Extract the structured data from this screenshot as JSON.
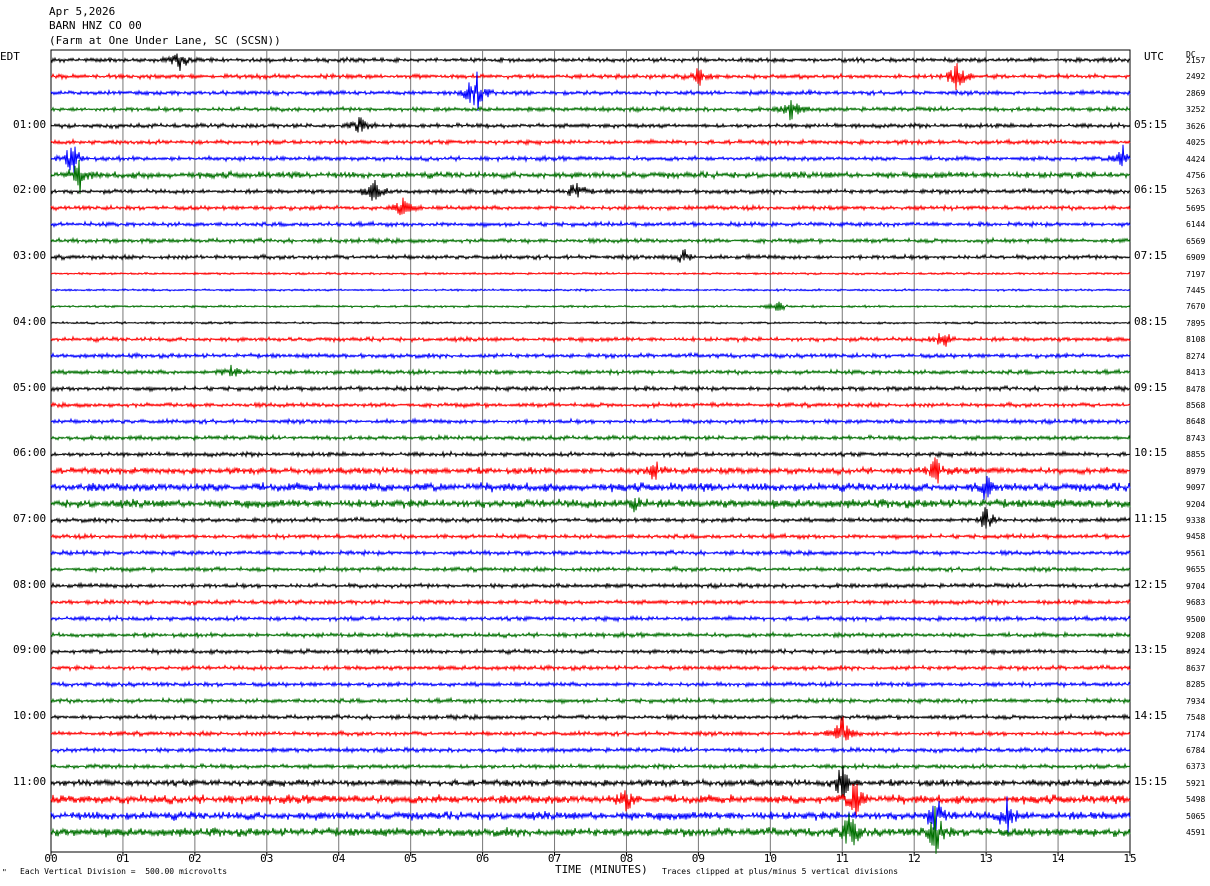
{
  "header": {
    "date": "Apr 5,2026",
    "station": "BARN HNZ CO 00",
    "location": "(Farm at One Under Lane, SC (SCSN))"
  },
  "labels": {
    "left_tz": "EDT",
    "right_tz": "UTC",
    "dc_label": "DC"
  },
  "footer": {
    "scale_note": "Each Vertical Division =  500.00 microvolts",
    "xaxis_title": "TIME (MINUTES)",
    "clip_note": "Traces clipped at plus/minus 5 vertical divisions",
    "corner_mark": "\""
  },
  "colors": {
    "cycle": [
      "#000000",
      "#ff0000",
      "#0000ff",
      "#007000"
    ]
  },
  "chart_data": {
    "type": "line",
    "title": "BARN HNZ CO 00",
    "xlabel": "TIME (MINUTES)",
    "xlim": [
      0,
      15
    ],
    "x_ticks": [
      "00",
      "01",
      "02",
      "03",
      "04",
      "05",
      "06",
      "07",
      "08",
      "09",
      "10",
      "11",
      "12",
      "13",
      "14",
      "15"
    ],
    "rows": 48,
    "minutes_per_row": 15,
    "left_hour_labels": [
      "01:00",
      "02:00",
      "03:00",
      "04:00",
      "05:00",
      "06:00",
      "07:00",
      "08:00",
      "09:00",
      "10:00",
      "11:00"
    ],
    "right_hour_labels": [
      "05:15",
      "06:15",
      "07:15",
      "08:15",
      "09:15",
      "10:15",
      "11:15",
      "12:15",
      "13:15",
      "14:15",
      "15:15"
    ],
    "dc_offsets": [
      "2157",
      "2492",
      "2869",
      "3252",
      "3626",
      "4025",
      "4424",
      "4756",
      "5263",
      "5695",
      "6144",
      "6569",
      "6909",
      "7197",
      "7445",
      "7670",
      "7895",
      "8108",
      "8274",
      "8413",
      "8478",
      "8568",
      "8648",
      "8743",
      "8855",
      "8979",
      "9097",
      "9204",
      "9338",
      "9458",
      "9561",
      "9655",
      "9704",
      "9683",
      "9500",
      "9208",
      "8924",
      "8637",
      "8285",
      "7934",
      "7548",
      "7174",
      "6784",
      "6373",
      "5921",
      "5498",
      "5065",
      "4591"
    ],
    "noise_level": [
      2,
      2,
      2,
      2,
      2,
      2,
      2,
      3,
      2,
      2,
      2,
      2,
      2,
      1,
      1,
      1,
      1,
      2,
      2,
      2,
      2,
      2,
      2,
      2,
      2,
      3,
      4,
      4,
      2,
      2,
      2,
      2,
      2,
      2,
      2,
      2,
      2,
      2,
      2,
      2,
      2,
      2,
      2,
      2,
      3,
      4,
      4,
      4
    ],
    "events": [
      {
        "row": 0,
        "minute": 1.8,
        "amp": 12
      },
      {
        "row": 1,
        "minute": 9.0,
        "amp": 10
      },
      {
        "row": 1,
        "minute": 12.6,
        "amp": 20
      },
      {
        "row": 2,
        "minute": 5.9,
        "amp": 30
      },
      {
        "row": 3,
        "minute": 10.3,
        "amp": 14
      },
      {
        "row": 4,
        "minute": 4.3,
        "amp": 10
      },
      {
        "row": 6,
        "minute": 0.3,
        "amp": 18
      },
      {
        "row": 6,
        "minute": 14.9,
        "amp": 18
      },
      {
        "row": 7,
        "minute": 0.4,
        "amp": 16
      },
      {
        "row": 8,
        "minute": 4.5,
        "amp": 14
      },
      {
        "row": 8,
        "minute": 7.3,
        "amp": 12
      },
      {
        "row": 9,
        "minute": 4.9,
        "amp": 12
      },
      {
        "row": 12,
        "minute": 8.8,
        "amp": 8
      },
      {
        "row": 15,
        "minute": 10.1,
        "amp": 8
      },
      {
        "row": 17,
        "minute": 12.4,
        "amp": 12
      },
      {
        "row": 19,
        "minute": 2.5,
        "amp": 10
      },
      {
        "row": 25,
        "minute": 8.4,
        "amp": 10
      },
      {
        "row": 25,
        "minute": 12.3,
        "amp": 14
      },
      {
        "row": 26,
        "minute": 13.0,
        "amp": 12
      },
      {
        "row": 27,
        "minute": 8.1,
        "amp": 10
      },
      {
        "row": 28,
        "minute": 13.0,
        "amp": 16
      },
      {
        "row": 41,
        "minute": 11.0,
        "amp": 20
      },
      {
        "row": 44,
        "minute": 11.0,
        "amp": 22
      },
      {
        "row": 45,
        "minute": 8.0,
        "amp": 12
      },
      {
        "row": 45,
        "minute": 11.2,
        "amp": 24
      },
      {
        "row": 46,
        "minute": 12.3,
        "amp": 20
      },
      {
        "row": 47,
        "minute": 11.1,
        "amp": 24
      },
      {
        "row": 47,
        "minute": 12.3,
        "amp": 26
      },
      {
        "row": 46,
        "minute": 13.3,
        "amp": 18
      }
    ]
  }
}
